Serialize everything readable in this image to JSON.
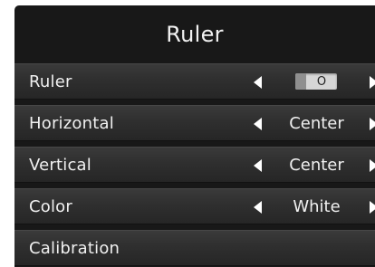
{
  "menu": {
    "title": "Ruler",
    "rows": [
      {
        "label": "Ruler",
        "control": "toggle",
        "value": "O"
      },
      {
        "label": "Horizontal",
        "control": "select",
        "value": "Center"
      },
      {
        "label": "Vertical",
        "control": "select",
        "value": "Center"
      },
      {
        "label": "Color",
        "control": "select",
        "value": "White"
      },
      {
        "label": "Calibration",
        "control": "action"
      }
    ]
  },
  "icons": {
    "left": "triangle-left-icon",
    "right": "triangle-right-icon"
  },
  "colors": {
    "panel": "#181818",
    "row": "#2f2f2f",
    "text": "#f0f0f0",
    "toggle_track": "#d6d6d6",
    "toggle_knob": "#8f8f8f"
  }
}
